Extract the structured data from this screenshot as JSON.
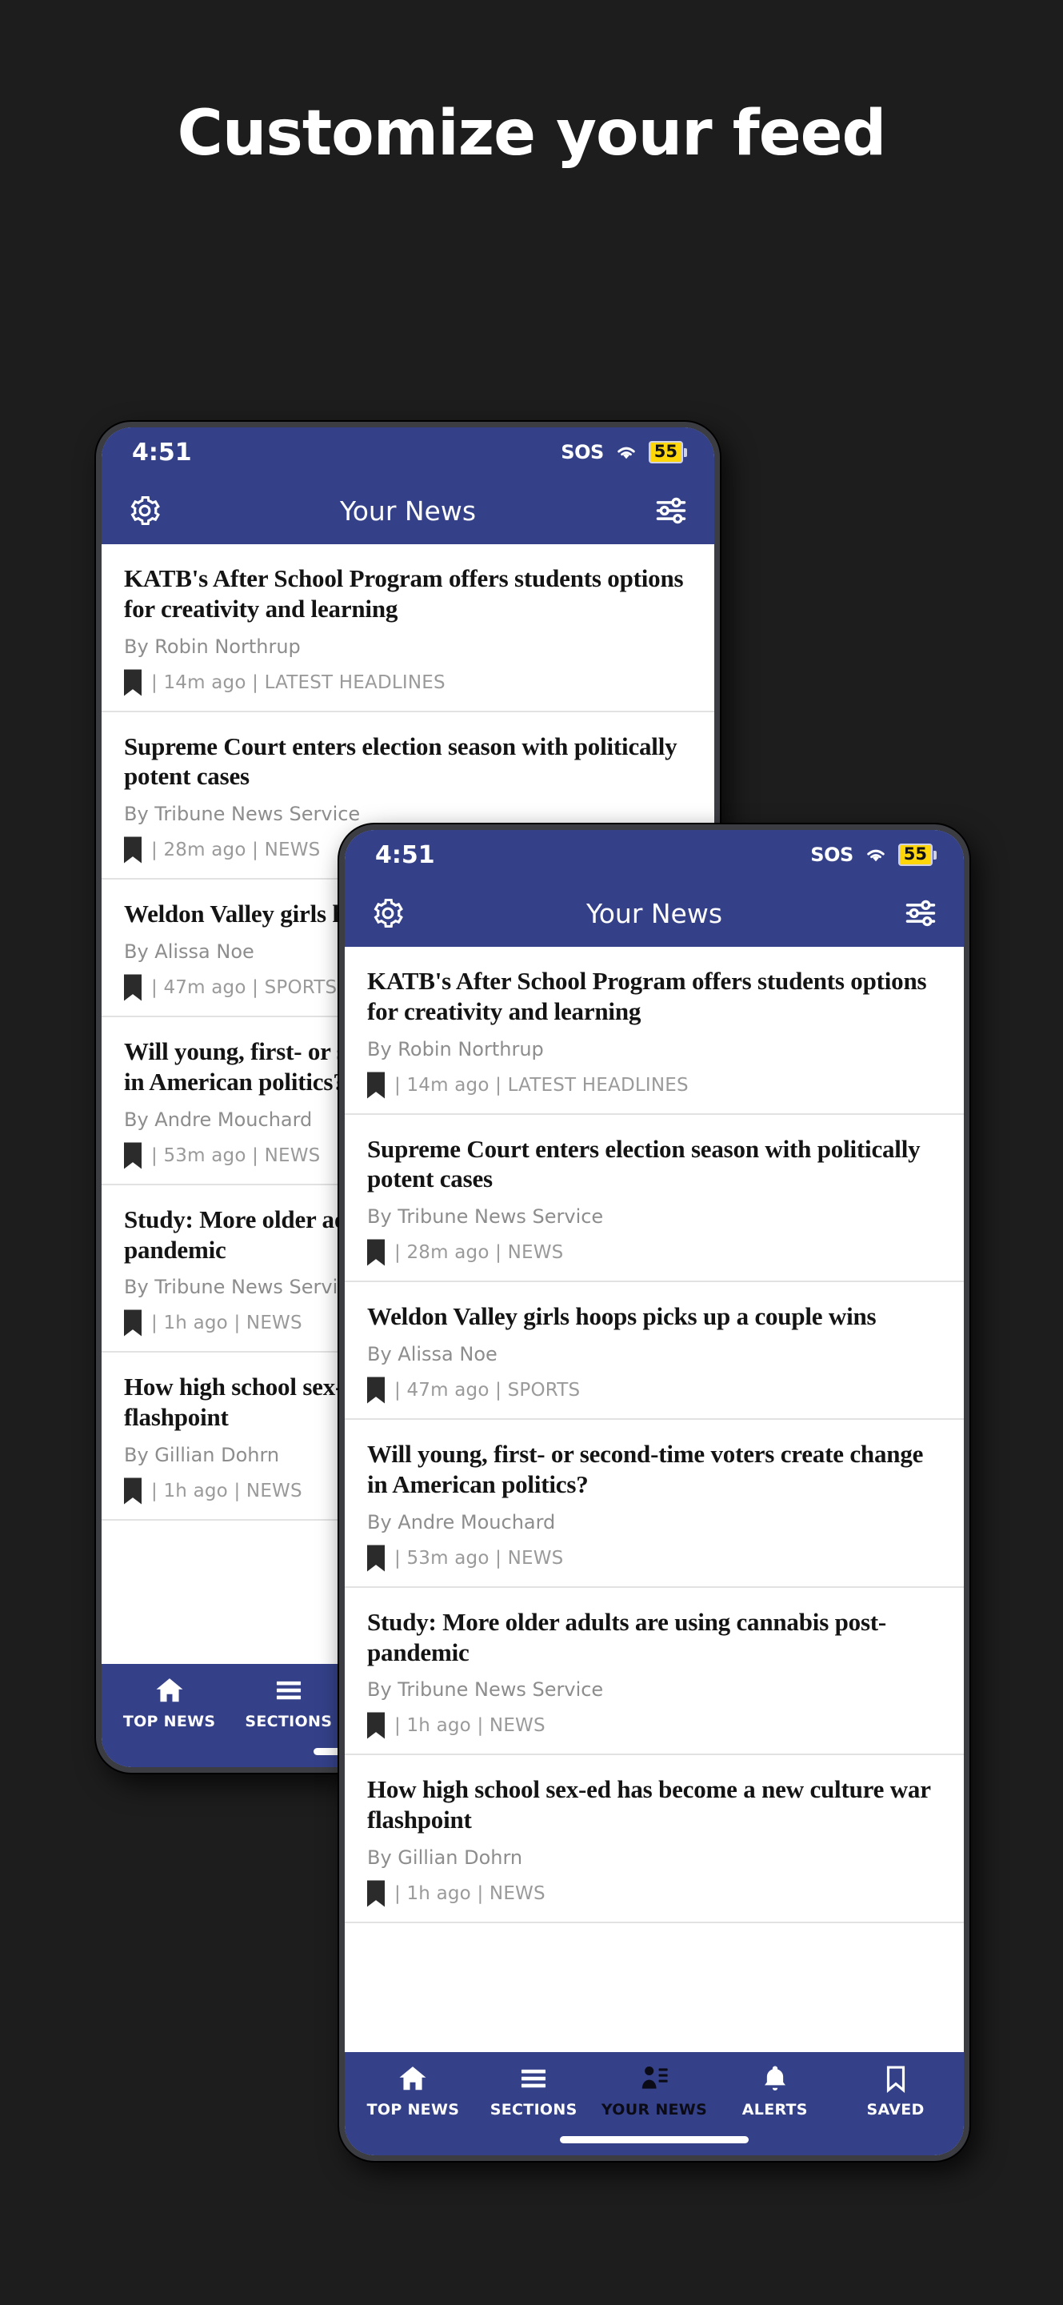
{
  "hero": {
    "title": "Customize your feed"
  },
  "theme": {
    "background": "#1d1d1d",
    "brand_blue": "#344189",
    "battery_yellow": "#ffd60a",
    "headline_color": "#141414",
    "muted_text": "#9a9a9a"
  },
  "status_bar": {
    "time": "4:51",
    "sos_label": "SOS",
    "wifi_icon": "wifi-icon",
    "battery_level": "55"
  },
  "app_header": {
    "settings_icon": "gear-icon",
    "title": "Your News",
    "filter_icon": "sliders-icon"
  },
  "feed": {
    "articles": [
      {
        "headline": "KATB's After School Program offers students options for creativity and learning",
        "byline": "By Robin Northrup",
        "meta": "| 14m ago | LATEST HEADLINES"
      },
      {
        "headline": "Supreme Court enters election season with politically potent cases",
        "byline": "By Tribune News Service",
        "meta": "| 28m ago | NEWS"
      },
      {
        "headline": "Weldon Valley girls hoops picks up a couple wins",
        "byline": "By Alissa Noe",
        "meta": "| 47m ago | SPORTS"
      },
      {
        "headline": "Will young, first- or second-time voters create change in American politics?",
        "byline": "By Andre Mouchard",
        "meta": "| 53m ago | NEWS"
      },
      {
        "headline": "Study: More older adults are using cannabis post-pandemic",
        "byline": "By Tribune News Service",
        "meta": "| 1h ago | NEWS"
      },
      {
        "headline": "How high school sex-ed has become a new culture war flashpoint",
        "byline": "By Gillian Dohrn",
        "meta": "| 1h ago | NEWS"
      }
    ]
  },
  "bottom_nav": {
    "items": [
      {
        "label": "TOP NEWS",
        "icon": "home-icon",
        "active": false
      },
      {
        "label": "SECTIONS",
        "icon": "hamburger-icon",
        "active": false
      },
      {
        "label": "YOUR NEWS",
        "icon": "person-list-icon",
        "active": true
      },
      {
        "label": "ALERTS",
        "icon": "bell-icon",
        "active": false
      },
      {
        "label": "SAVED",
        "icon": "bookmark-icon",
        "active": false
      }
    ]
  }
}
